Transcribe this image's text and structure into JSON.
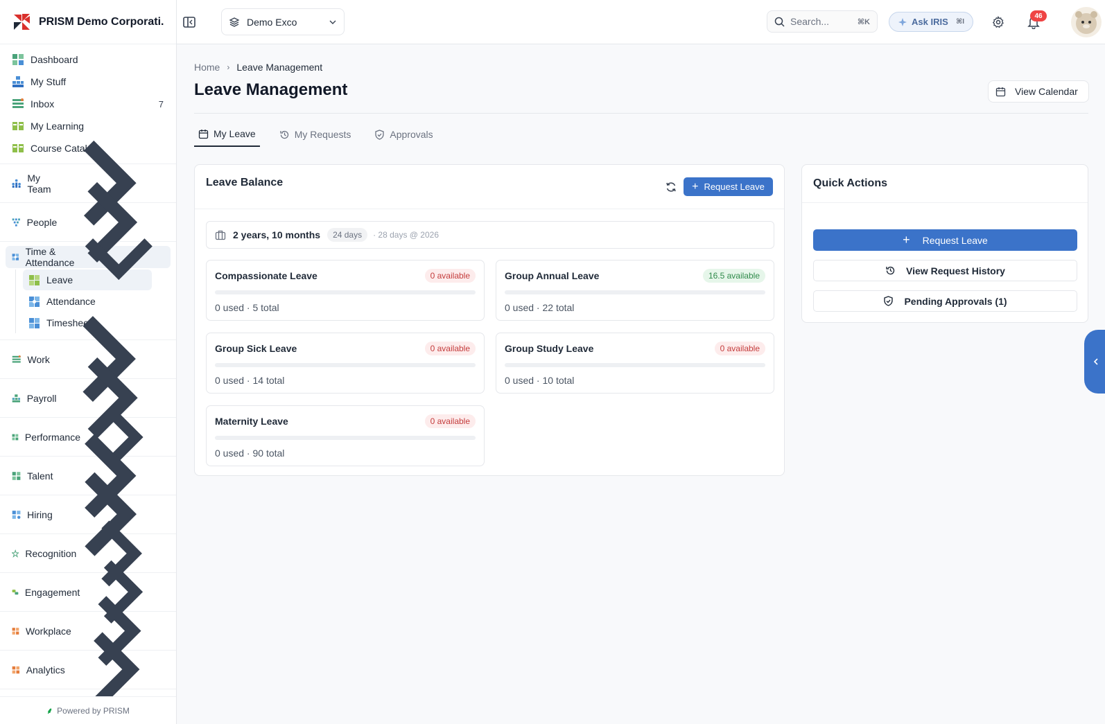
{
  "brand": {
    "name": "PRISM Demo Corporati..."
  },
  "sidebar": {
    "top_items": [
      {
        "label": "Dashboard",
        "icon": "dashboard-icon"
      },
      {
        "label": "My Stuff",
        "icon": "my-stuff-icon"
      },
      {
        "label": "Inbox",
        "icon": "inbox-icon",
        "count": "7"
      },
      {
        "label": "My Learning",
        "icon": "learning-icon"
      },
      {
        "label": "Course Catalog",
        "icon": "catalog-icon"
      }
    ],
    "my_team": "My Team",
    "people": "People",
    "time_attendance": {
      "label": "Time & Attendance",
      "children": [
        "Leave",
        "Attendance",
        "Timesheets"
      ],
      "active_child": "Leave"
    },
    "sections": [
      "Work",
      "Payroll",
      "Performance",
      "Talent",
      "Hiring",
      "Recognition",
      "Engagement",
      "Workplace",
      "Analytics"
    ],
    "powered_by": "Powered by PRISM"
  },
  "topbar": {
    "org_selector": "Demo Exco",
    "search_placeholder": "Search...",
    "search_shortcut": "⌘K",
    "ask_label": "Ask IRIS",
    "ask_shortcut": "⌘I",
    "notification_count": "46"
  },
  "page": {
    "breadcrumb": [
      "Home",
      "Leave Management"
    ],
    "title": "Leave Management",
    "view_calendar": "View Calendar",
    "tabs": [
      "My Leave",
      "My Requests",
      "Approvals"
    ],
    "active_tab": "My Leave"
  },
  "leave_balance": {
    "title": "Leave Balance",
    "request_button": "Request Leave",
    "tenure": "2 years, 10 months",
    "tenure_days": "24 days",
    "tenure_note": "· 28 days @ 2026",
    "leaves": [
      {
        "name": "Compassionate Leave",
        "available": "0 available",
        "status": "red",
        "usage": "0 used · 5 total",
        "progress": 0
      },
      {
        "name": "Group Annual Leave",
        "available": "16.5 available",
        "status": "green",
        "usage": "0 used · 22 total",
        "progress": 0
      },
      {
        "name": "Group Sick Leave",
        "available": "0 available",
        "status": "red",
        "usage": "0 used · 14 total",
        "progress": 0
      },
      {
        "name": "Group Study Leave",
        "available": "0 available",
        "status": "red",
        "usage": "0 used · 10 total",
        "progress": 0
      },
      {
        "name": "Maternity Leave",
        "available": "0 available",
        "status": "red",
        "usage": "0 used · 90 total",
        "progress": 0
      }
    ]
  },
  "quick_actions": {
    "title": "Quick Actions",
    "request_leave": "Request Leave",
    "view_history": "View Request History",
    "pending_approvals": "Pending Approvals (1)"
  },
  "colors": {
    "primary": "#3b73c9",
    "danger": "#c43c3c",
    "success": "#2f8a4a"
  }
}
